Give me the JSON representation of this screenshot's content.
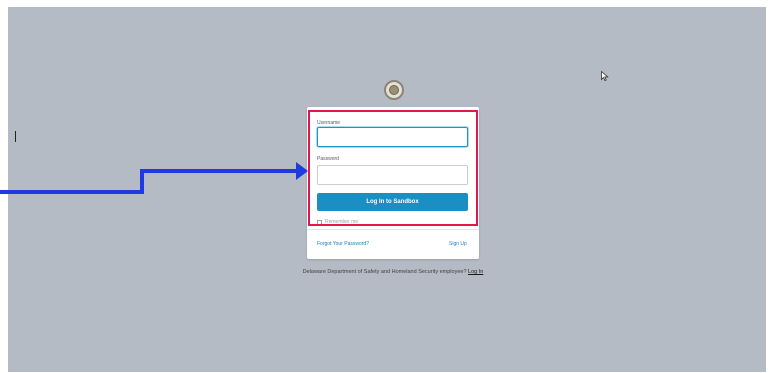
{
  "login": {
    "username_label": "Username",
    "username_value": "",
    "password_label": "Password",
    "password_value": "",
    "submit_label": "Log In to Sandbox",
    "remember_label": "Remember me",
    "forgot_label": "Forgot Your Password?",
    "signup_label": "Sign Up"
  },
  "footer": {
    "employee_text": "Delaware Department of Safety and Homeland Security employee?",
    "login_link": "Log In"
  },
  "annotation": {
    "highlight_color": "#e5164a",
    "arrow_color": "#1f3be0"
  },
  "icons": {
    "logo": "state-seal-icon",
    "cursor": "mouse-pointer-icon"
  }
}
